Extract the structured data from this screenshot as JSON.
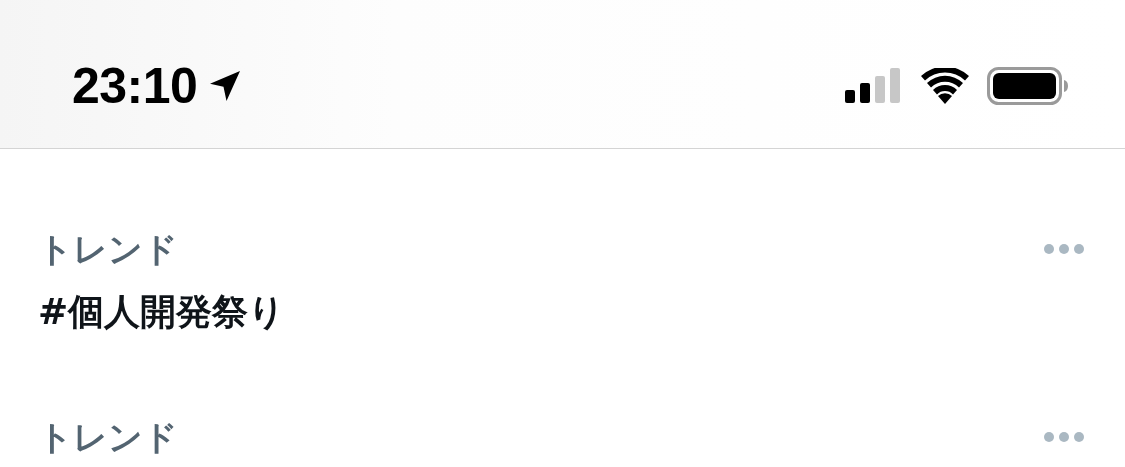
{
  "status_bar": {
    "time": "23:10"
  },
  "trends": [
    {
      "category": "トレンド",
      "title": "#個人開発祭り"
    },
    {
      "category": "トレンド"
    }
  ]
}
